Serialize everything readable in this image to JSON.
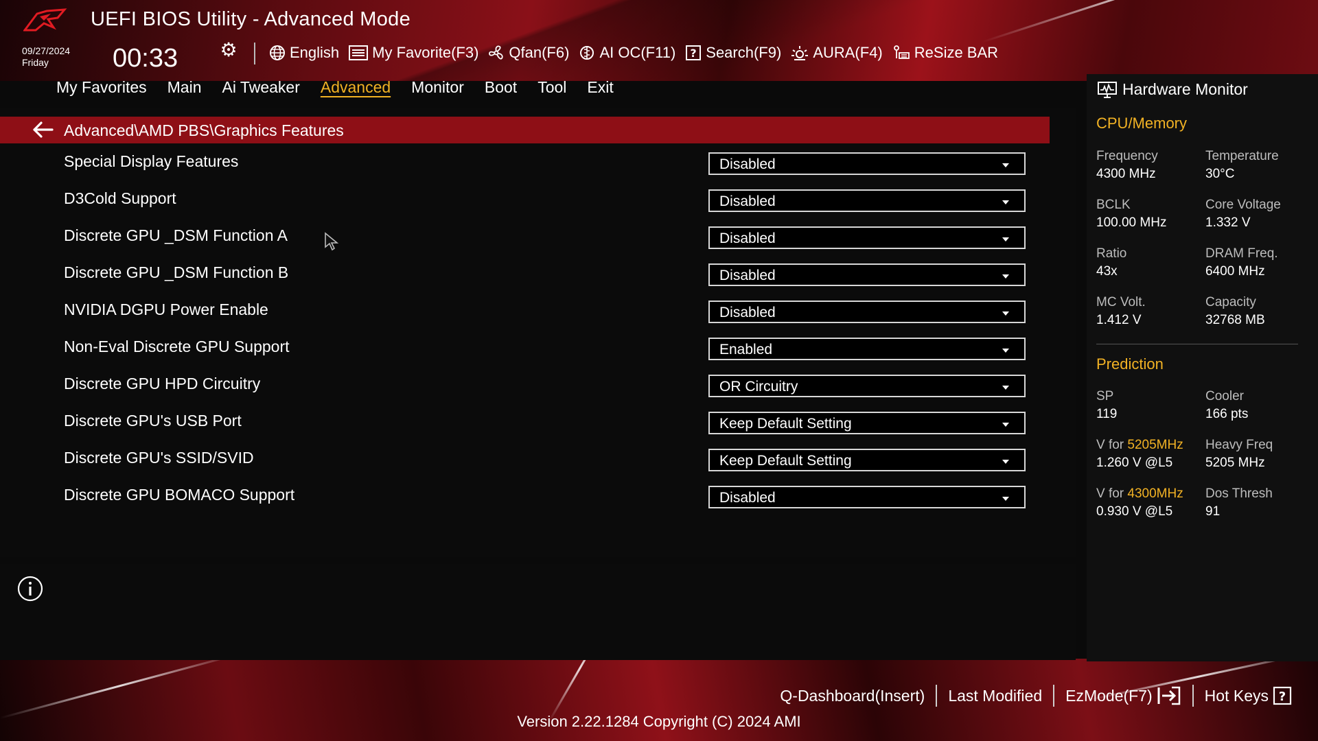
{
  "header": {
    "title": "UEFI BIOS Utility - Advanced Mode",
    "date": "09/27/2024",
    "day": "Friday",
    "time": "00:33",
    "tools": [
      {
        "label": "English",
        "icon": "globe-icon"
      },
      {
        "label": "My Favorite(F3)",
        "icon": "favorite-list-icon"
      },
      {
        "label": "Qfan(F6)",
        "icon": "fan-icon"
      },
      {
        "label": "AI OC(F11)",
        "icon": "ai-chip-icon"
      },
      {
        "label": "Search(F9)",
        "icon": "search-help-icon"
      },
      {
        "label": "AURA(F4)",
        "icon": "aura-light-icon"
      },
      {
        "label": "ReSize BAR",
        "icon": "resize-bar-icon"
      }
    ]
  },
  "tabs": [
    "My Favorites",
    "Main",
    "Ai Tweaker",
    "Advanced",
    "Monitor",
    "Boot",
    "Tool",
    "Exit"
  ],
  "active_tab": "Advanced",
  "breadcrumb": "Advanced\\AMD PBS\\Graphics Features",
  "settings": [
    {
      "label": "Special Display Features",
      "value": "Disabled"
    },
    {
      "label": "D3Cold Support",
      "value": "Disabled"
    },
    {
      "label": "Discrete GPU _DSM Function A",
      "value": "Disabled"
    },
    {
      "label": "Discrete GPU _DSM Function B",
      "value": "Disabled"
    },
    {
      "label": "NVIDIA DGPU Power Enable",
      "value": "Disabled"
    },
    {
      "label": "Non-Eval Discrete GPU Support",
      "value": "Enabled"
    },
    {
      "label": "Discrete GPU HPD Circuitry",
      "value": "OR Circuitry"
    },
    {
      "label": "Discrete GPU's USB Port",
      "value": "Keep Default Setting"
    },
    {
      "label": "Discrete GPU's SSID/SVID",
      "value": "Keep Default Setting"
    },
    {
      "label": "Discrete GPU BOMACO Support",
      "value": "Disabled"
    }
  ],
  "hardware_monitor": {
    "title": "Hardware Monitor",
    "cpu_memory": {
      "heading": "CPU/Memory",
      "items": [
        {
          "label": "Frequency",
          "value": "4300 MHz"
        },
        {
          "label": "Temperature",
          "value": "30°C"
        },
        {
          "label": "BCLK",
          "value": "100.00 MHz"
        },
        {
          "label": "Core Voltage",
          "value": "1.332 V"
        },
        {
          "label": "Ratio",
          "value": "43x"
        },
        {
          "label": "DRAM Freq.",
          "value": "6400 MHz"
        },
        {
          "label": "MC Volt.",
          "value": "1.412 V"
        },
        {
          "label": "Capacity",
          "value": "32768 MB"
        }
      ]
    },
    "prediction": {
      "heading": "Prediction",
      "sp_label": "SP",
      "sp_value": "119",
      "cooler_label": "Cooler",
      "cooler_value": "166 pts",
      "v1_prefix": "V for ",
      "v1_freq": "5205MHz",
      "v1_value": "1.260 V @L5",
      "heavy_label": "Heavy Freq",
      "heavy_value": "5205 MHz",
      "v2_prefix": "V for ",
      "v2_freq": "4300MHz",
      "v2_value": "0.930 V @L5",
      "dos_label": "Dos Thresh",
      "dos_value": "91"
    }
  },
  "footer": {
    "qdashboard": "Q-Dashboard(Insert)",
    "last_modified": "Last Modified",
    "ezmode": "EzMode(F7)",
    "hotkeys": "Hot Keys",
    "version": "Version 2.22.1284 Copyright (C) 2024 AMI"
  },
  "colors": {
    "accent": "#f2b224",
    "breadcrumb_bar": "#8e0f16",
    "background": "#0b0b0b"
  }
}
